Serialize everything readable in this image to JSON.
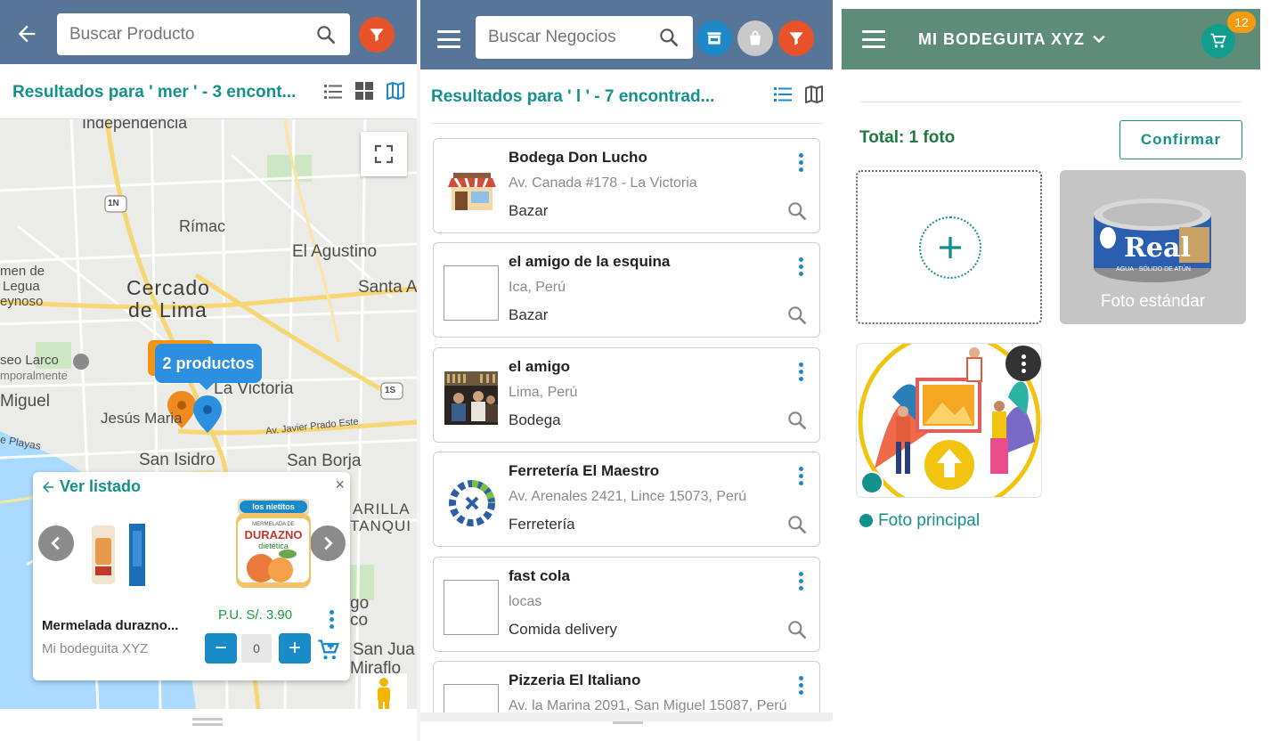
{
  "panel1": {
    "search": {
      "placeholder": "Buscar Producto"
    },
    "results_text": "Resultados para ' mer ' - 3 encont...",
    "map_labels": {
      "independencia": "Independencia",
      "rimac": "Rímac",
      "el_agustino": "El Agustino",
      "cercado_1": "Cercado",
      "cercado_2": "de Lima",
      "santa": "Santa A",
      "men_de": "men de",
      "legua": "Legua",
      "eynoso": "eynoso",
      "seo_larco": "seo Larco",
      "mporalmente": "mporalmente",
      "la_victoria": "La Victoria",
      "miguel": "Miguel",
      "jesus_maria": "Jesús Maria",
      "av_javier": "Av. Javier Prado Este",
      "e_playas": "e Playas",
      "san_isidro": "San Isidro",
      "san_borja": "San Borja",
      "arilla": "ARILLA",
      "tanqui": "TANQUI",
      "go": "go",
      "co": "co",
      "san_jua": "San Jua",
      "miraflo": "Miraflo",
      "route_1n": "1N",
      "route_1s": "1S"
    },
    "cluster_label": "2 productos",
    "card": {
      "ver_listado": "Ver listado",
      "close": "×",
      "product_name": "Mermelada durazno...",
      "shop_name": "Mi bodeguita XYZ",
      "price": "P.U. S/. 3.90",
      "qty": "0",
      "minus": "−",
      "plus": "+",
      "jar_brand": "los nietitos",
      "jar_line1": "MERMELADA DE",
      "jar_line2": "DURAZNO",
      "jar_line3": "dietética"
    },
    "colors": {
      "header": "#577596",
      "accent": "#14918a",
      "filter": "#e8522b",
      "qty_button": "#1a8bc9"
    }
  },
  "panel2": {
    "search": {
      "placeholder": "Buscar Negocios"
    },
    "results_text": "Resultados para ' l ' - 7 encontrad...",
    "stores": [
      {
        "name": "Bodega Don Lucho",
        "address": "Av. Canada #178 - La Victoria",
        "category": "Bazar",
        "image": "store-icon"
      },
      {
        "name": "el amigo de la esquina",
        "address": "Ica, Perú",
        "category": "Bazar",
        "image": "empty"
      },
      {
        "name": "el amigo",
        "address": "Lima, Perú",
        "category": "Bodega",
        "image": "photo"
      },
      {
        "name": "Ferretería El Maestro",
        "address": "Av. Arenales 2421, Lince 15073, Perú",
        "category": "Ferretería",
        "image": "gear-logo"
      },
      {
        "name": "fast cola",
        "address": "locas",
        "category": "Comida delivery",
        "image": "empty"
      },
      {
        "name": "Pizzeria El Italiano",
        "address": "Av. la Marina 2091, San Miguel 15087, Perú",
        "category": "",
        "image": "empty"
      }
    ],
    "colors": {
      "store_button": "#1e88c8",
      "bag_button": "#c9c9c9",
      "filter": "#e8522b"
    }
  },
  "panel3": {
    "shop_title": "MI BODEGUITA XYZ",
    "cart_badge": "12",
    "total": "Total: 1 foto",
    "confirm": "Confirmar",
    "standard_photo_label": "Foto estándar",
    "can_brand": "Real",
    "can_sub": "AGUA · SÓLIDO DE ATÚN",
    "main_photo_label": "Foto principal",
    "colors": {
      "header": "#5f8b79",
      "accent": "#14918a",
      "badge": "#f39c12"
    }
  }
}
